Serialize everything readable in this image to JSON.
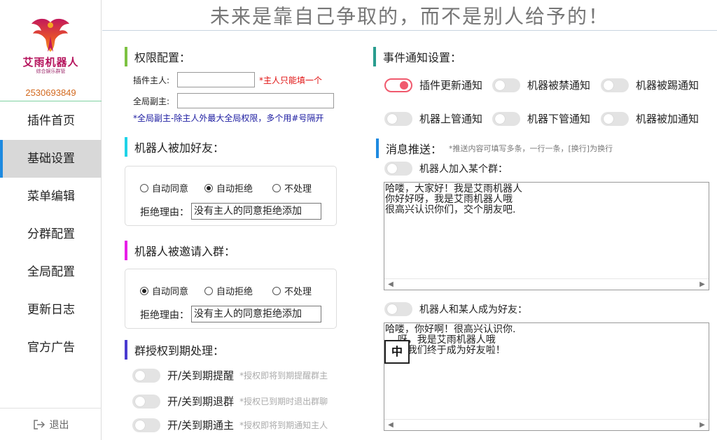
{
  "header": {
    "title": "未来是靠自己争取的，而不是别人给予的！"
  },
  "sidebar": {
    "logo_name": "艾雨机器人",
    "logo_sub": "综合娱乐群管",
    "qq": "2530693849",
    "items": [
      {
        "label": "插件首页"
      },
      {
        "label": "基础设置"
      },
      {
        "label": "菜单编辑"
      },
      {
        "label": "分群配置"
      },
      {
        "label": "全局配置"
      },
      {
        "label": "更新日志"
      },
      {
        "label": "官方广告"
      }
    ],
    "active_index": 1,
    "logout": "退出"
  },
  "permission": {
    "title": "权限配置：",
    "owner_label": "插件主人:",
    "owner_value": "",
    "owner_note": "*主人只能填一个",
    "deputy_label": "全局副主:",
    "deputy_value": "",
    "deputy_note": "*全局副主-除主人外最大全局权限，多个用#号隔开"
  },
  "friend_add": {
    "title": "机器人被加好友：",
    "options": [
      "自动同意",
      "自动拒绝",
      "不处理"
    ],
    "selected": 1,
    "reason_label": "拒绝理由：",
    "reason_value": "没有主人的同意拒绝添加"
  },
  "group_invite": {
    "title": "机器人被邀请入群：",
    "options": [
      "自动同意",
      "自动拒绝",
      "不处理"
    ],
    "selected": 0,
    "reason_label": "拒绝理由：",
    "reason_value": "没有主人的同意拒绝添加"
  },
  "expiry": {
    "title": "群授权到期处理：",
    "items": [
      {
        "label": "开/关到期提醒",
        "note": "*授权即将到期提醒群主",
        "on": false
      },
      {
        "label": "开/关到期退群",
        "note": "*授权已到期时退出群聊",
        "on": false
      },
      {
        "label": "开/关到期通主",
        "note": "*授权即将到期通知主人",
        "on": false
      }
    ]
  },
  "events": {
    "title": "事件通知设置：",
    "items": [
      {
        "label": "插件更新通知",
        "on": true
      },
      {
        "label": "机器被禁通知",
        "on": false
      },
      {
        "label": "机器被踢通知",
        "on": false
      },
      {
        "label": "机器上管通知",
        "on": false
      },
      {
        "label": "机器下管通知",
        "on": false
      },
      {
        "label": "机器被加通知",
        "on": false
      }
    ]
  },
  "push": {
    "title": "消息推送：",
    "hint": "*推送内容可填写多条，一行一条，[换行]为换行",
    "join_group": {
      "label": "机器人加入某个群：",
      "on": false,
      "text": "哈喽，大家好！我是艾雨机器人\n你好好呀，我是艾雨机器人哦\n很高兴认识你们，交个朋友吧."
    },
    "new_friend": {
      "label": "机器人和某人成为好友：",
      "on": false,
      "text": "哈喽，你好啊！很高兴认识你.\n    呀，我是艾雨机器人哦\n    ，我们终于成为好友啦！"
    },
    "ime_indicator": "中"
  },
  "colors": {
    "accent_blue": "#1e8ae0",
    "bar_green": "#7dc242",
    "bar_cyan": "#1fd3e8",
    "bar_magenta": "#e81ee8",
    "bar_indigo": "#4a3bd0",
    "bar_teal": "#2a9d8f",
    "toggle_on": "#f05a6e"
  }
}
